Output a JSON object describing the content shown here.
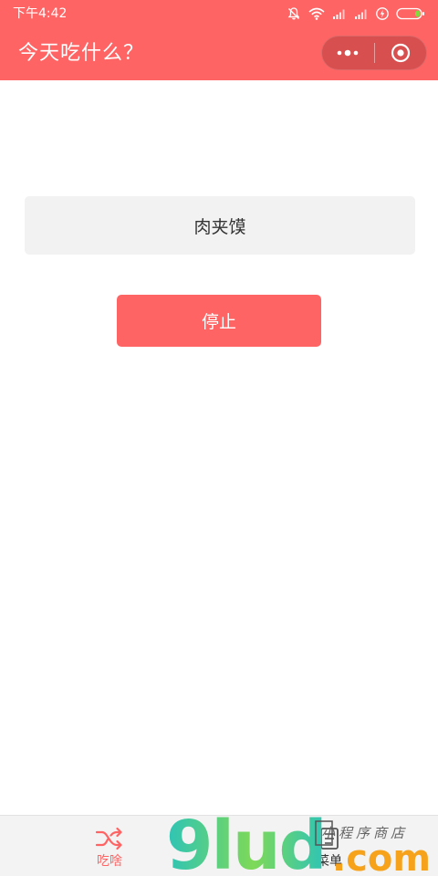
{
  "status_bar": {
    "time": "下午4:42"
  },
  "nav": {
    "title": "今天吃什么？",
    "more_icon": "more-dots-icon",
    "close_icon": "target-circle-icon"
  },
  "main": {
    "result_text": "肉夹馍",
    "stop_label": "停止"
  },
  "tabbar": {
    "items": [
      {
        "label": "吃啥",
        "icon": "shuffle-icon",
        "active": true
      },
      {
        "label": "菜单",
        "icon": "menu-icon",
        "active": false
      }
    ]
  },
  "watermark": {
    "brand": "9lud",
    "cn_text": "小程序商店",
    "domain": ".com"
  },
  "colors": {
    "accent": "#ff6464",
    "result_bg": "#f2f2f2",
    "tab_bg": "#f3f3f3"
  }
}
